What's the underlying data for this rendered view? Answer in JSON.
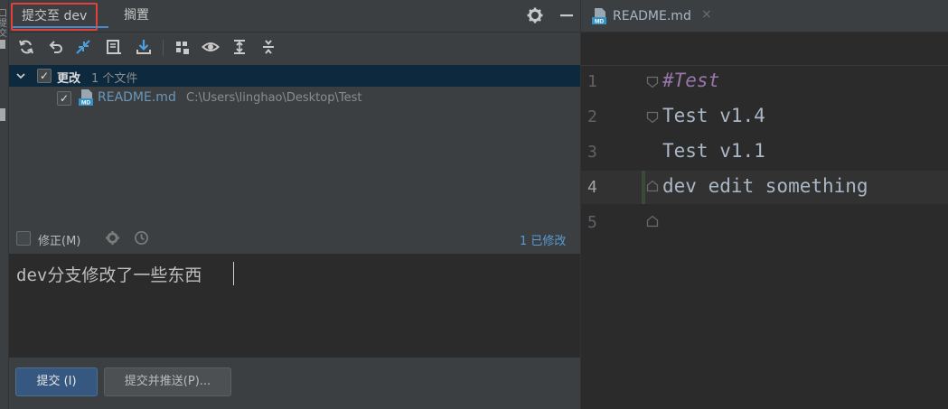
{
  "edge": {
    "label": "口 提交"
  },
  "tool_tabs": [
    {
      "label": "提交至 dev"
    },
    {
      "label": "搁置"
    }
  ],
  "changes": {
    "group_label": "更改",
    "group_count": "1 个文件",
    "file": {
      "name": "README.md",
      "path": "C:\\Users\\linghao\\Desktop\\Test"
    }
  },
  "amend": {
    "label": "修正(M)",
    "modified": "1 已修改"
  },
  "commit_message": "dev分支修改了一些东西",
  "buttons": {
    "commit": "提交 (I)",
    "commit_push": "提交并推送(P)..."
  },
  "editor": {
    "tab_label": "README.md",
    "tab_close": "×",
    "file_icon": "MD",
    "line_numbers": [
      "1",
      "2",
      "3",
      "4",
      "5"
    ],
    "lines": [
      "#Test",
      "Test v1.4",
      "Test v1.1",
      "dev edit something",
      ""
    ]
  },
  "colors": {
    "accent": "#4a88c7",
    "highlight_box": "#e0413a",
    "selection": "#0d293e"
  }
}
